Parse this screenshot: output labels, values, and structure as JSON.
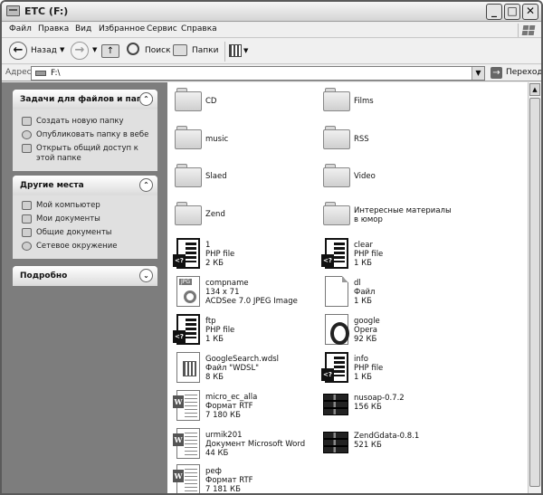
{
  "window": {
    "title": "ETC (F:)"
  },
  "menu": [
    "Файл",
    "Правка",
    "Вид",
    "Избранное",
    "Сервис",
    "Справка"
  ],
  "toolbar": {
    "back_label": "Назад",
    "search_label": "Поиск",
    "folders_label": "Папки"
  },
  "address": {
    "label": "Адрес:",
    "value": "F:\\",
    "go_label": "Переход"
  },
  "tasks_panel": {
    "title": "Задачи для файлов и папок",
    "items": [
      {
        "label": "Создать новую папку",
        "icon": "new-folder-icon"
      },
      {
        "label": "Опубликовать папку в вебе",
        "icon": "globe-icon"
      },
      {
        "label": "Открыть общий доступ к этой папке",
        "icon": "share-icon"
      }
    ]
  },
  "places_panel": {
    "title": "Другие места",
    "items": [
      {
        "label": "Мой компьютер",
        "icon": "computer-icon"
      },
      {
        "label": "Мои документы",
        "icon": "documents-icon"
      },
      {
        "label": "Общие документы",
        "icon": "shared-documents-icon"
      },
      {
        "label": "Сетевое окружение",
        "icon": "network-icon"
      }
    ]
  },
  "details_panel": {
    "title": "Подробно"
  },
  "files": [
    {
      "name": "CD",
      "kind": "folder"
    },
    {
      "name": "Films",
      "kind": "folder"
    },
    {
      "name": "music",
      "kind": "folder"
    },
    {
      "name": "RSS",
      "kind": "folder"
    },
    {
      "name": "Slaed",
      "kind": "folder"
    },
    {
      "name": "Video",
      "kind": "folder"
    },
    {
      "name": "Zend",
      "kind": "folder"
    },
    {
      "name": "Интересные материалы в юмор",
      "kind": "folder"
    },
    {
      "name": "1",
      "type": "PHP file",
      "size": "2 КБ",
      "kind": "php"
    },
    {
      "name": "clear",
      "type": "PHP file",
      "size": "1 КБ",
      "kind": "php"
    },
    {
      "name": "compname",
      "type": "134 x 71",
      "size": "ACDSee 7.0 JPEG Image",
      "kind": "jpg"
    },
    {
      "name": "dl",
      "type": "Файл",
      "size": "1 КБ",
      "kind": "blank"
    },
    {
      "name": "ftp",
      "type": "PHP file",
      "size": "1 КБ",
      "kind": "php"
    },
    {
      "name": "google",
      "type": "Opera",
      "size": "92 КБ",
      "kind": "opera"
    },
    {
      "name": "GoogleSearch.wdsl",
      "type": "Файл \"WDSL\"",
      "size": "8 КБ",
      "kind": "wsdl"
    },
    {
      "name": "info",
      "type": "PHP file",
      "size": "1 КБ",
      "kind": "php"
    },
    {
      "name": "micro_ec_alla",
      "type": "Формат RTF",
      "size": "7 180 КБ",
      "kind": "word"
    },
    {
      "name": "nusoap-0.7.2",
      "type": "",
      "size": "156 КБ",
      "kind": "rar"
    },
    {
      "name": "urmik201",
      "type": "Документ Microsoft Word",
      "size": "44 КБ",
      "kind": "word"
    },
    {
      "name": "ZendGdata-0.8.1",
      "type": "",
      "size": "521 КБ",
      "kind": "rar"
    },
    {
      "name": "реф",
      "type": "Формат RTF",
      "size": "7 181 КБ",
      "kind": "word"
    }
  ]
}
